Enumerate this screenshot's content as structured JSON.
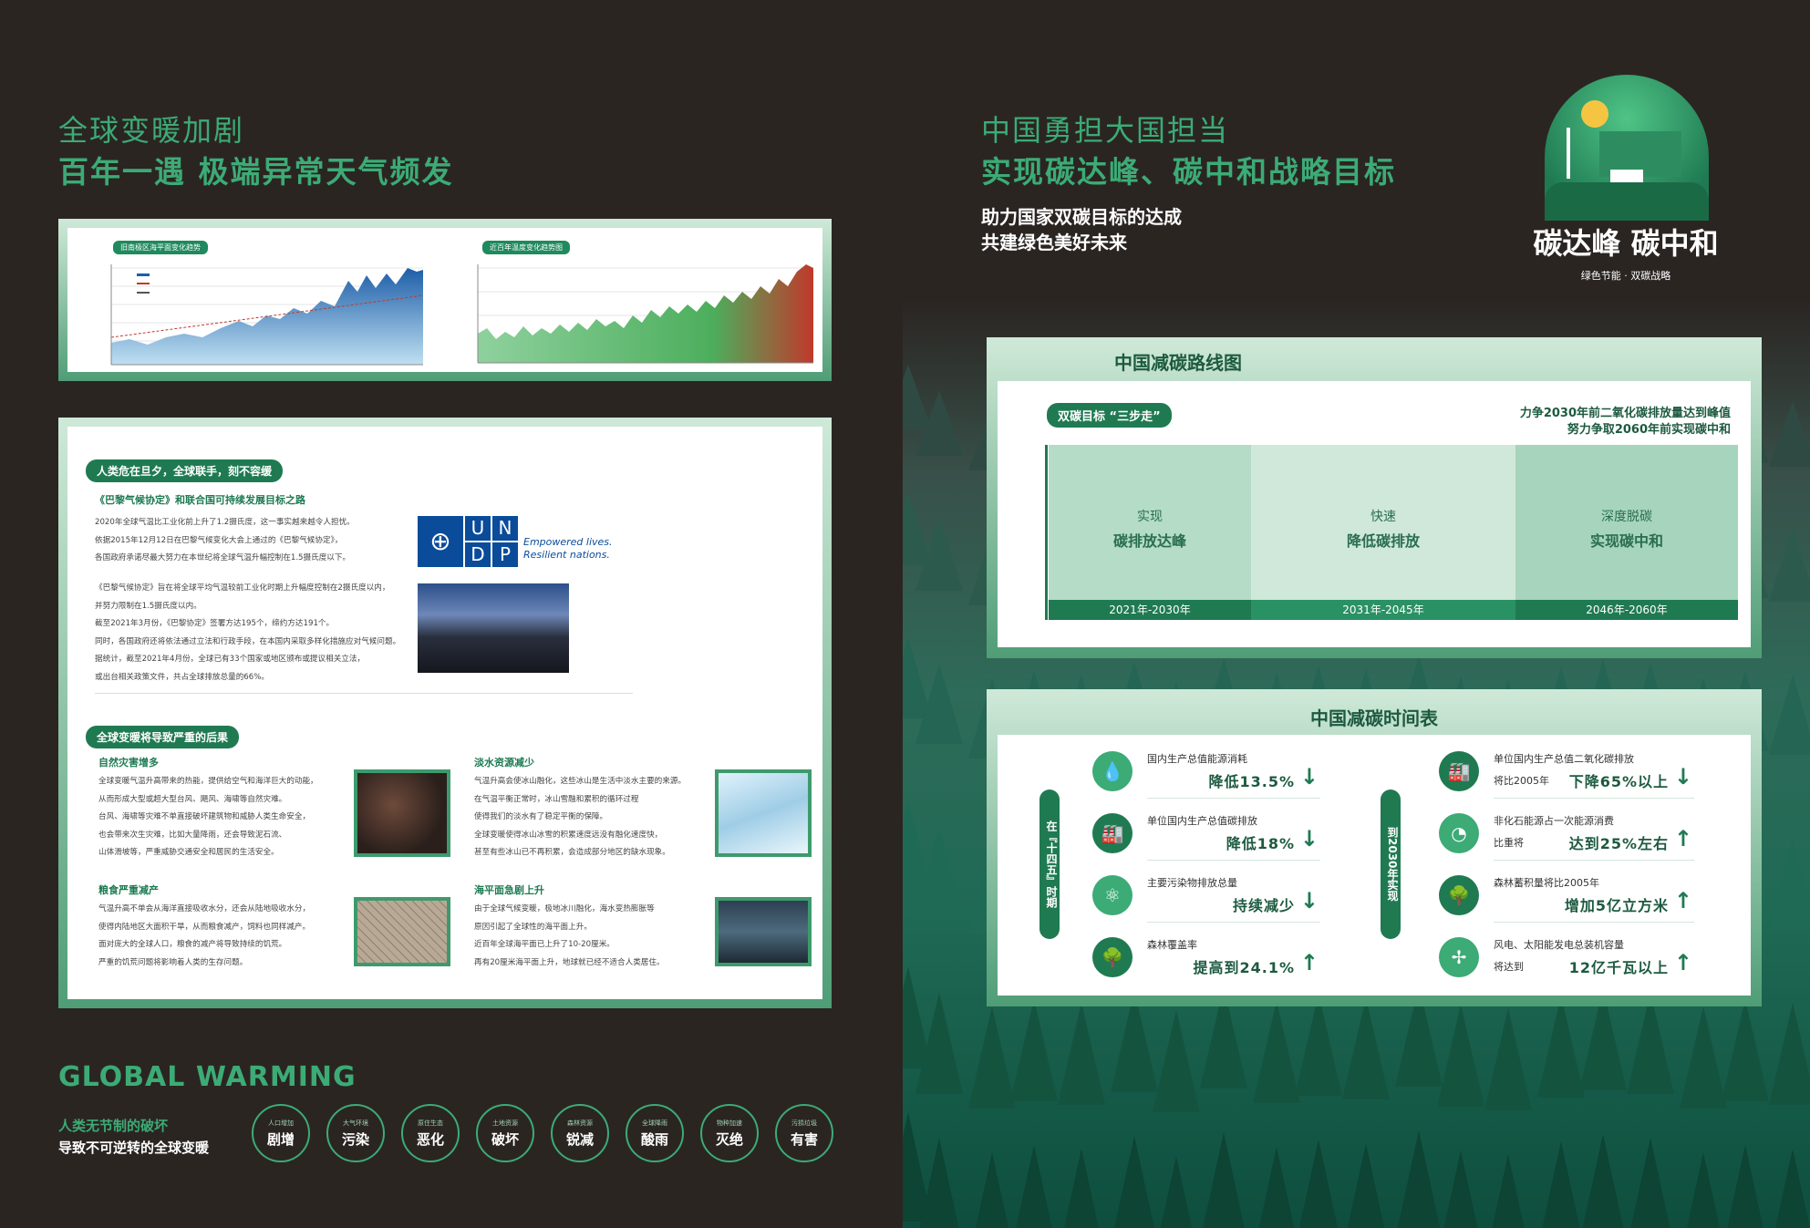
{
  "left": {
    "header1": "全球变暖加剧",
    "header2": "百年一遇 极端异常天气频发",
    "chart_panel": {
      "chart1_title": "旧南极区海平面变化趋势",
      "chart2_title": "近百年温度变化趋势图"
    },
    "content_panel": {
      "section1_pill": "人类危在旦夕，全球联手，刻不容缓",
      "section1_subtitle": "《巴黎气候协定》和联合国可持续发展目标之路",
      "para1": [
        "2020年全球气温比工业化前上升了1.2摄氏度，这一事实越来越令人担忧。",
        "依据2015年12月12日在巴黎气候变化大会上通过的《巴黎气候协定》，",
        "各国政府承诺尽最大努力在本世纪将全球气温升幅控制在1.5摄氏度以下。"
      ],
      "para2": [
        "《巴黎气候协定》旨在将全球平均气温较前工业化时期上升幅度控制在2摄氏度以内，",
        "并努力限制在1.5摄氏度以内。",
        "截至2021年3月份，《巴黎协定》签署方达195个，缔约方达191个。",
        "同时，各国政府还将依法通过立法和行政手段，在本国内采取多样化措施应对气候问题。",
        "据统计，截至2021年4月份，全球已有33个国家或地区颁布或提议相关立法，",
        "或出台相关政策文件，共占全球排放总量的66%。"
      ],
      "undp_letters": [
        "U",
        "N",
        "D",
        "P"
      ],
      "undp_tagline1": "Empowered lives.",
      "undp_tagline2": "Resilient nations.",
      "section2_pill": "全球变暖将导致严重的后果",
      "blocks": [
        {
          "title": "自然灾害增多",
          "lines": [
            "全球变暖气温升高带来的热能，提供给空气和海洋巨大的动能，",
            "从而形成大型或超大型台风、飓风、海啸等自然灾难。",
            "台风、海啸等灾难不单直接破坏建筑物和威胁人类生命安全，",
            "也会带来次生灾难，比如大量降雨，还会导致泥石流、",
            "山体滑坡等，严重威胁交通安全和居民的生活安全。"
          ]
        },
        {
          "title": "淡水资源减少",
          "lines": [
            "气温升高会使冰山融化，这些冰山是生活中淡水主要的来源。",
            "在气温平衡正常时，冰山雪融和累积的循环过程",
            "使得我们的淡水有了稳定平衡的保障。",
            "全球变暖使得冰山冰雪的积累速度远没有融化速度快，",
            "甚至有些冰山已不再积累，会造成部分地区的缺水现象。"
          ]
        },
        {
          "title": "粮食严重减产",
          "lines": [
            "气温升高不单会从海洋直接吸收水分，还会从陆地吸收水分，",
            "使得内陆地区大面积干旱，从而粮食减产，饲料也同样减产。",
            "面对庞大的全球人口，粮食的减产将导致持续的饥荒。",
            "严重的饥荒问题将影响着人类的生存问题。"
          ]
        },
        {
          "title": "海平面急剧上升",
          "lines": [
            "由于全球气候变暖，极地冰川融化，海水变热膨胀等",
            "原因引起了全球性的海平面上升。",
            "近百年全球海平面已上升了10-20厘米。",
            "再有20厘米海平面上升，地球就已经不适合人类居住。"
          ]
        }
      ]
    },
    "global_warming": "GLOBAL WARMING",
    "gw_line1": "人类无节制的破坏",
    "gw_line2": "导致不可逆转的全球变暖",
    "circles": [
      {
        "small": "人口增加",
        "big": "剧增"
      },
      {
        "small": "大气环境",
        "big": "污染"
      },
      {
        "small": "原住生态",
        "big": "恶化"
      },
      {
        "small": "土地资源",
        "big": "破坏"
      },
      {
        "small": "森林资源",
        "big": "锐减"
      },
      {
        "small": "全球降雨",
        "big": "酸雨"
      },
      {
        "small": "物种加速",
        "big": "灭绝"
      },
      {
        "small": "污损垃圾",
        "big": "有害"
      }
    ]
  },
  "right": {
    "header1": "中国勇担大国担当",
    "header2": "实现碳达峰、碳中和战略目标",
    "sub1": "助力国家双碳目标的达成",
    "sub2": "共建绿色美好未来",
    "logo_title": "碳达峰 碳中和",
    "logo_sub": "绿色节能 · 双碳战略",
    "roadmap": {
      "title": "中国减碳路线图",
      "pill": "双碳目标 “三步走”",
      "goal1": "力争2030年前二氧化碳排放量达到峰值",
      "goal2": "努力争取2060年前实现碳中和",
      "stages": [
        {
          "l1": "实现",
          "l2": "碳排放达峰",
          "years": "2021年-2030年"
        },
        {
          "l1": "快速",
          "l2": "降低碳排放",
          "years": "2031年-2045年"
        },
        {
          "l1": "深度脱碳",
          "l2": "实现碳中和",
          "years": "2046年-2060年"
        }
      ]
    },
    "timetable": {
      "title": "中国减碳时间表",
      "left_label": "在『十四五』时期",
      "right_label": "到2030年实现",
      "left_items": [
        {
          "text": "国内生产总值能源消耗",
          "prefix": "",
          "value": "降低13.5%",
          "arrow": "down",
          "icon": "drop-icon"
        },
        {
          "text": "单位国内生产总值碳排放",
          "prefix": "",
          "value": "降低18%",
          "arrow": "down",
          "icon": "factory-icon"
        },
        {
          "text": "主要污染物排放总量",
          "prefix": "",
          "value": "持续减少",
          "arrow": "down",
          "icon": "molecule-icon"
        },
        {
          "text": "森林覆盖率",
          "prefix": "",
          "value": "提高到24.1%",
          "arrow": "up",
          "icon": "tree-icon"
        }
      ],
      "right_items": [
        {
          "text": "单位国内生产总值二氧化碳排放",
          "prefix": "将比2005年",
          "value": "下降65%以上",
          "arrow": "down",
          "icon": "factory-icon"
        },
        {
          "text": "非化石能源占一次能源消费",
          "prefix": "比重将",
          "value": "达到25%左右",
          "arrow": "up",
          "icon": "pie-icon"
        },
        {
          "text": "森林蓄积量将比2005年",
          "prefix": "",
          "value": "增加5亿立方米",
          "arrow": "up",
          "icon": "tree-icon"
        },
        {
          "text": "风电、太阳能发电总装机容量",
          "prefix": "将达到",
          "value": "12亿千瓦以上",
          "arrow": "up",
          "icon": "windmill-icon"
        }
      ]
    }
  },
  "colors": {
    "background": "#2b2522",
    "accent_green": "#3cab76",
    "dark_green": "#1f7a52",
    "panel_light": "#cfe9d8"
  }
}
